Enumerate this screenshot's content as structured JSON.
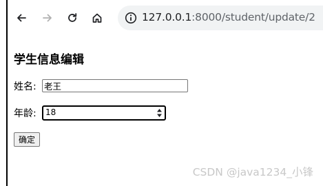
{
  "browser": {
    "url_host": "127.0.0.1",
    "url_rest": ":8000/student/update/2"
  },
  "page": {
    "title": "学生信息编辑",
    "name_label": "姓名:",
    "name_value": "老王",
    "age_label": "年龄:",
    "age_value": "18",
    "submit_label": "确定"
  },
  "watermark": "CSDN @java1234_小锋"
}
